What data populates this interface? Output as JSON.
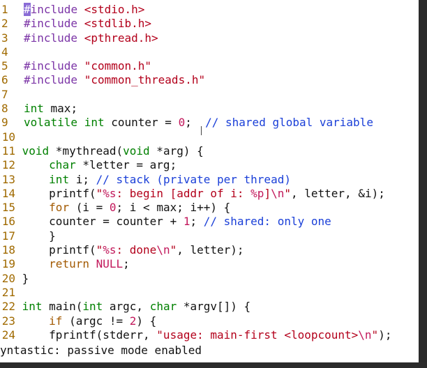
{
  "editor": {
    "lines": [
      {
        "n": "1",
        "segs": [
          {
            "c": "cursor",
            "t": "#"
          },
          {
            "c": "t-pp",
            "t": "include"
          },
          {
            "c": "t-plain",
            "t": " "
          },
          {
            "c": "t-str",
            "t": "<stdio.h>"
          }
        ]
      },
      {
        "n": "2",
        "segs": [
          {
            "c": "t-pp",
            "t": "#include"
          },
          {
            "c": "t-plain",
            "t": " "
          },
          {
            "c": "t-str",
            "t": "<stdlib.h>"
          }
        ]
      },
      {
        "n": "3",
        "segs": [
          {
            "c": "t-pp",
            "t": "#include"
          },
          {
            "c": "t-plain",
            "t": " "
          },
          {
            "c": "t-str",
            "t": "<pthread.h>"
          }
        ]
      },
      {
        "n": "4",
        "segs": []
      },
      {
        "n": "5",
        "segs": [
          {
            "c": "t-pp",
            "t": "#include"
          },
          {
            "c": "t-plain",
            "t": " "
          },
          {
            "c": "t-str",
            "t": "\"common.h\""
          }
        ]
      },
      {
        "n": "6",
        "segs": [
          {
            "c": "t-pp",
            "t": "#include"
          },
          {
            "c": "t-plain",
            "t": " "
          },
          {
            "c": "t-str",
            "t": "\"common_threads.h\""
          }
        ]
      },
      {
        "n": "7",
        "segs": []
      },
      {
        "n": "8",
        "segs": [
          {
            "c": "t-type",
            "t": "int"
          },
          {
            "c": "t-plain",
            "t": " max;"
          }
        ]
      },
      {
        "n": "9",
        "segs": [
          {
            "c": "t-type",
            "t": "volatile"
          },
          {
            "c": "t-plain",
            "t": " "
          },
          {
            "c": "t-type",
            "t": "int"
          },
          {
            "c": "t-plain",
            "t": " counter = "
          },
          {
            "c": "t-num",
            "t": "0"
          },
          {
            "c": "t-plain",
            "t": ";  "
          },
          {
            "c": "t-com",
            "t": "// shared global variable"
          }
        ]
      },
      {
        "n": "10",
        "segs": []
      },
      {
        "n": "11",
        "segs": [
          {
            "c": "t-type",
            "t": "void"
          },
          {
            "c": "t-plain",
            "t": " *mythread("
          },
          {
            "c": "t-type",
            "t": "void"
          },
          {
            "c": "t-plain",
            "t": " *arg) {"
          }
        ]
      },
      {
        "n": "12",
        "segs": [
          {
            "c": "t-plain",
            "t": "    "
          },
          {
            "c": "t-type",
            "t": "char"
          },
          {
            "c": "t-plain",
            "t": " *letter = arg;"
          }
        ]
      },
      {
        "n": "13",
        "segs": [
          {
            "c": "t-plain",
            "t": "    "
          },
          {
            "c": "t-type",
            "t": "int"
          },
          {
            "c": "t-plain",
            "t": " i; "
          },
          {
            "c": "t-com",
            "t": "// stack (private per thread)"
          }
        ]
      },
      {
        "n": "14",
        "segs": [
          {
            "c": "t-plain",
            "t": "    printf("
          },
          {
            "c": "t-str",
            "t": "\""
          },
          {
            "c": "t-esc",
            "t": "%s"
          },
          {
            "c": "t-str",
            "t": ": begin [addr of i: "
          },
          {
            "c": "t-esc",
            "t": "%p"
          },
          {
            "c": "t-str",
            "t": "]"
          },
          {
            "c": "t-esc",
            "t": "\\n"
          },
          {
            "c": "t-str",
            "t": "\""
          },
          {
            "c": "t-plain",
            "t": ", letter, &i);"
          }
        ]
      },
      {
        "n": "15",
        "segs": [
          {
            "c": "t-plain",
            "t": "    "
          },
          {
            "c": "t-kw",
            "t": "for"
          },
          {
            "c": "t-plain",
            "t": " (i = "
          },
          {
            "c": "t-num",
            "t": "0"
          },
          {
            "c": "t-plain",
            "t": "; i < max; i++) {"
          }
        ]
      },
      {
        "n": "16",
        "segs": [
          {
            "c": "t-plain",
            "t": "    counter = counter + "
          },
          {
            "c": "t-num",
            "t": "1"
          },
          {
            "c": "t-plain",
            "t": "; "
          },
          {
            "c": "t-com",
            "t": "// shared: only one"
          }
        ]
      },
      {
        "n": "17",
        "segs": [
          {
            "c": "t-plain",
            "t": "    }"
          }
        ]
      },
      {
        "n": "18",
        "segs": [
          {
            "c": "t-plain",
            "t": "    printf("
          },
          {
            "c": "t-str",
            "t": "\""
          },
          {
            "c": "t-esc",
            "t": "%s"
          },
          {
            "c": "t-str",
            "t": ": done"
          },
          {
            "c": "t-esc",
            "t": "\\n"
          },
          {
            "c": "t-str",
            "t": "\""
          },
          {
            "c": "t-plain",
            "t": ", letter);"
          }
        ]
      },
      {
        "n": "19",
        "segs": [
          {
            "c": "t-plain",
            "t": "    "
          },
          {
            "c": "t-kw",
            "t": "return"
          },
          {
            "c": "t-plain",
            "t": " "
          },
          {
            "c": "t-num",
            "t": "NULL"
          },
          {
            "c": "t-plain",
            "t": ";"
          }
        ]
      },
      {
        "n": "20",
        "segs": [
          {
            "c": "t-plain",
            "t": "}"
          }
        ]
      },
      {
        "n": "21",
        "segs": []
      },
      {
        "n": "22",
        "segs": [
          {
            "c": "t-type",
            "t": "int"
          },
          {
            "c": "t-plain",
            "t": " main("
          },
          {
            "c": "t-type",
            "t": "int"
          },
          {
            "c": "t-plain",
            "t": " argc, "
          },
          {
            "c": "t-type",
            "t": "char"
          },
          {
            "c": "t-plain",
            "t": " *argv[]) {"
          }
        ]
      },
      {
        "n": "23",
        "segs": [
          {
            "c": "t-plain",
            "t": "    "
          },
          {
            "c": "t-kw",
            "t": "if"
          },
          {
            "c": "t-plain",
            "t": " (argc != "
          },
          {
            "c": "t-num",
            "t": "2"
          },
          {
            "c": "t-plain",
            "t": ") {"
          }
        ]
      },
      {
        "n": "24",
        "segs": [
          {
            "c": "t-plain",
            "t": "    fprintf(stderr, "
          },
          {
            "c": "t-str",
            "t": "\"usage: main-first <loopcount>"
          },
          {
            "c": "t-esc",
            "t": "\\n"
          },
          {
            "c": "t-str",
            "t": "\""
          },
          {
            "c": "t-plain",
            "t": ");"
          }
        ]
      }
    ]
  },
  "status": {
    "message": "yntastic: passive mode enabled"
  }
}
